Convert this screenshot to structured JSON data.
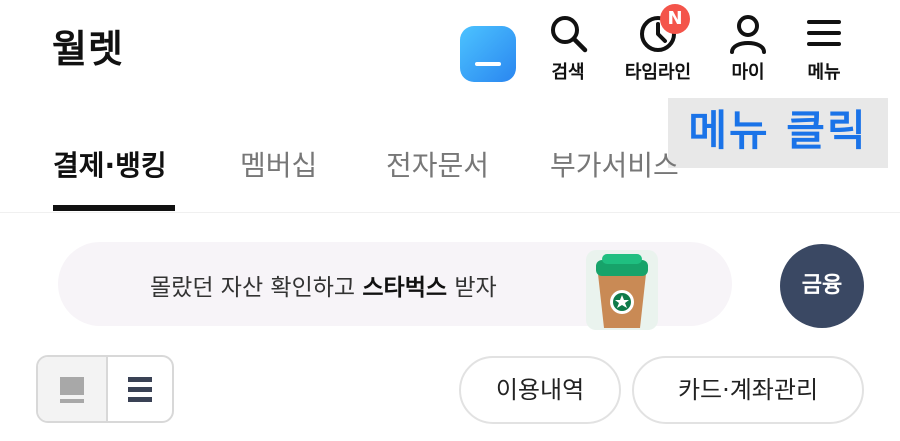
{
  "header": {
    "title": "월렛",
    "app_icon": "wallet-app-icon",
    "actions": [
      {
        "label": "검색",
        "icon": "search-icon"
      },
      {
        "label": "타임라인",
        "icon": "clock-icon",
        "badge": "N"
      },
      {
        "label": "마이",
        "icon": "person-icon"
      },
      {
        "label": "메뉴",
        "icon": "hamburger-menu-icon"
      }
    ]
  },
  "overlay": {
    "label": "메뉴 클릭"
  },
  "tabs": [
    {
      "label": "결제·뱅킹",
      "active": true
    },
    {
      "label": "멤버십",
      "active": false
    },
    {
      "label": "전자문서",
      "active": false
    },
    {
      "label": "부가서비스",
      "active": false
    }
  ],
  "promo": {
    "text_prefix": "몰랐던 자산 확인하고 ",
    "text_bold": "스타벅스",
    "text_suffix": " 받자",
    "image": "coffee-cup-icon"
  },
  "finance_button": {
    "label": "금융"
  },
  "view_toggle": {
    "left_icon": "card-view-icon",
    "right_icon": "list-view-icon"
  },
  "buttons": {
    "usage_history": "이용내역",
    "card_account_manage": "카드·계좌관리"
  },
  "colors": {
    "accent_blue": "#1a73e8",
    "badge_red": "#f4544a",
    "finance_navy": "#3a4863",
    "promo_bg": "#f7f4f8"
  }
}
